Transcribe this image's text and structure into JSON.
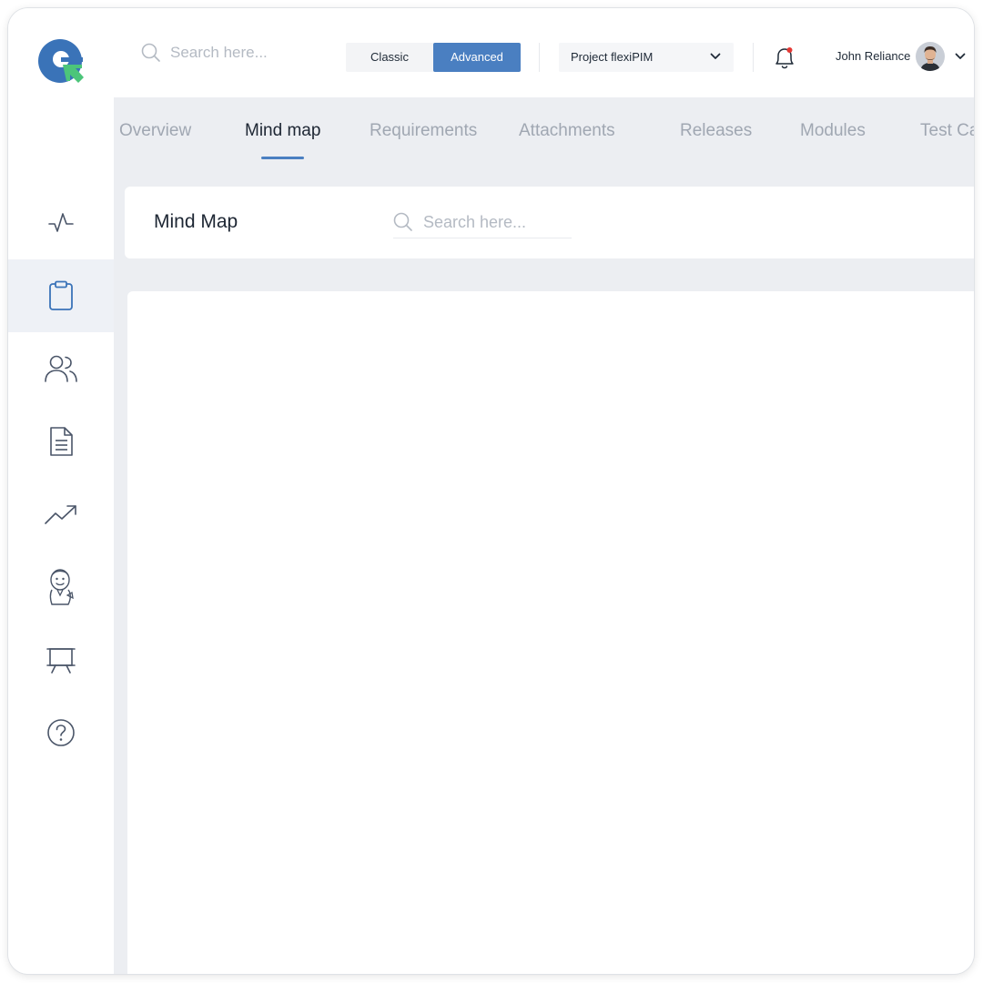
{
  "topbar": {
    "search_placeholder": "Search here...",
    "mode_classic": "Classic",
    "mode_advanced": "Advanced",
    "project_selected": "Project flexiPIM",
    "user_name": "John Reliance",
    "accent_color": "#4a7fc1",
    "notification_dot_color": "#e53935"
  },
  "tabs": [
    {
      "label": "Overview"
    },
    {
      "label": "Mind map",
      "active": true
    },
    {
      "label": "Requirements"
    },
    {
      "label": "Attachments"
    },
    {
      "label": "Releases"
    },
    {
      "label": "Modules"
    },
    {
      "label": "Test Ca"
    }
  ],
  "page": {
    "title": "Mind Map",
    "search_placeholder": "Search here..."
  },
  "sidebar": {
    "items": [
      {
        "icon": "activity-icon"
      },
      {
        "icon": "clipboard-icon",
        "active": true
      },
      {
        "icon": "users-icon"
      },
      {
        "icon": "document-icon"
      },
      {
        "icon": "trending-up-icon"
      },
      {
        "icon": "jenkins-icon"
      },
      {
        "icon": "presentation-board-icon"
      },
      {
        "icon": "help-icon"
      }
    ]
  }
}
